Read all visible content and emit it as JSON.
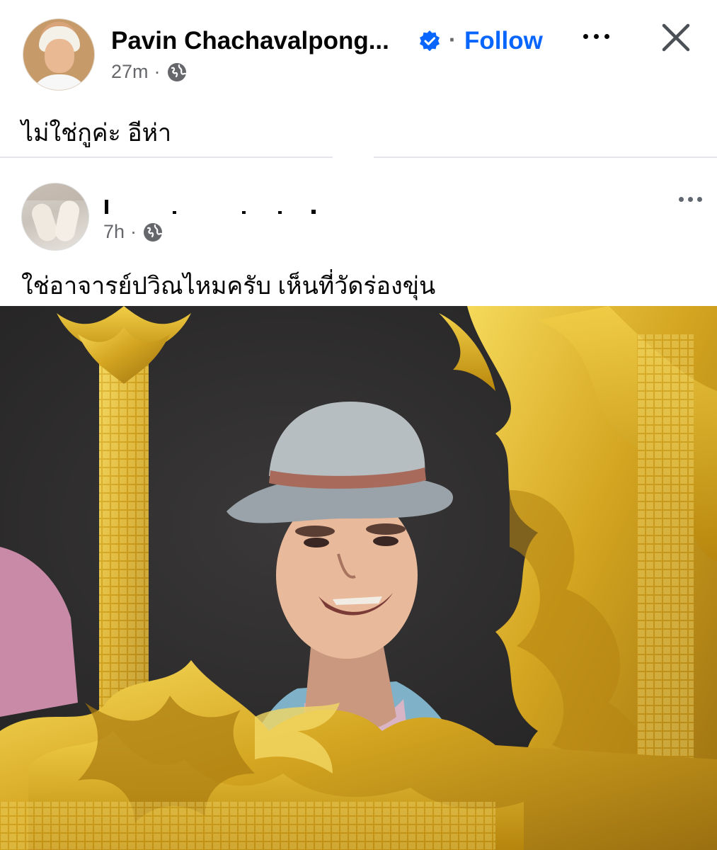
{
  "post": {
    "author_name": "Pavin Chachavalpong...",
    "separator": "·",
    "follow_label": "Follow",
    "timestamp": "27m",
    "meta_separator": "·",
    "privacy_icon": "globe-icon",
    "text": "ไม่ใช่กูค่ะ อีห่า"
  },
  "shared_post": {
    "timestamp": "7h",
    "meta_separator": "·",
    "privacy_icon": "globe-icon",
    "text": "ใช่อาจารย์ปวิณไหมครับ เห็นที่วัดร่องขุ่น"
  },
  "colors": {
    "accent": "#0866ff",
    "secondary_text": "#65676b",
    "gold": "#d4a520"
  }
}
